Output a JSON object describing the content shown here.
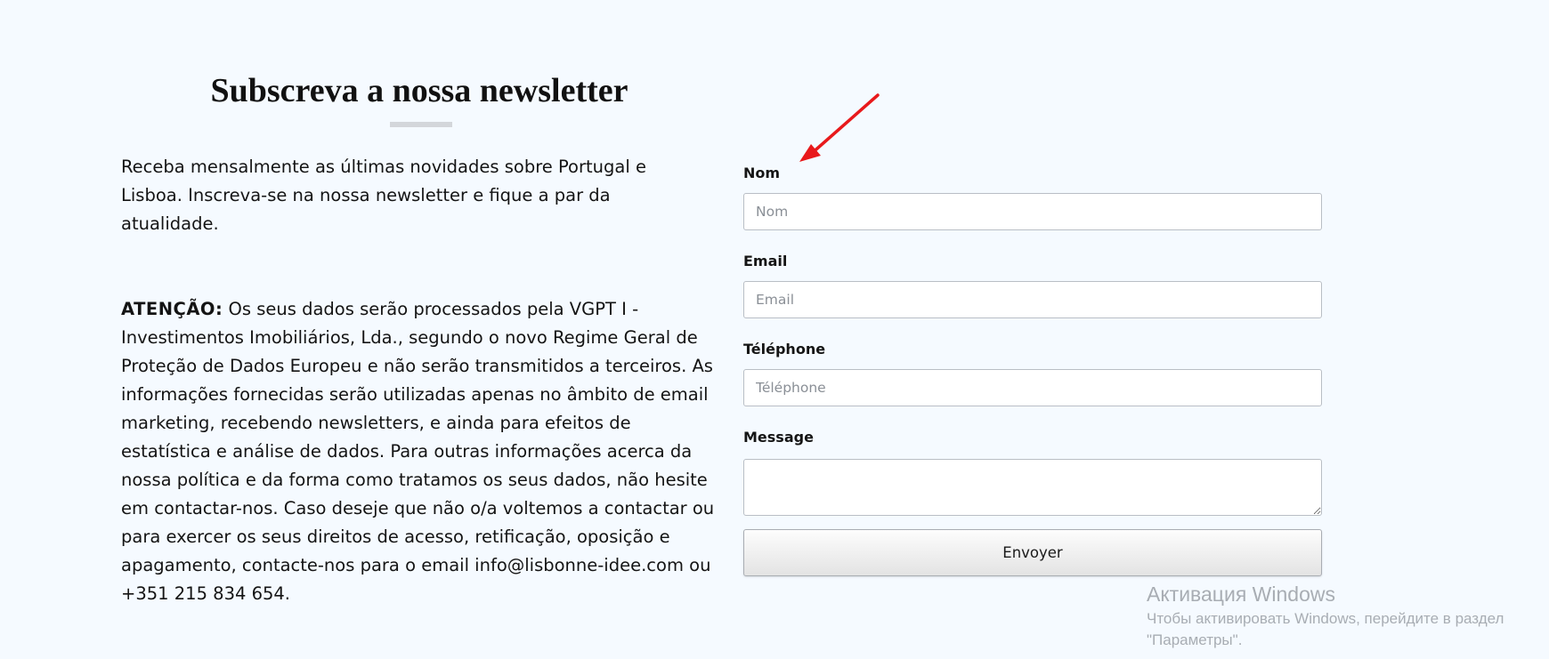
{
  "section": {
    "title": "Subscreva a nossa newsletter",
    "intro": "Receba mensalmente as últimas novidades sobre Portugal e Lisboa. Inscreva-se na nossa newsletter e fique a par da atualidade.",
    "notice_label": "ATENÇÃO:",
    "notice_text": " Os seus dados serão processados pela VGPT I - Investimentos Imobiliários, Lda., segundo o novo Regime Geral de Proteção de Dados Europeu e não serão transmitidos a terceiros. As informações fornecidas serão utilizadas apenas no âmbito de email marketing, recebendo newsletters, e ainda para efeitos de estatística e análise de dados. Para outras informações acerca da nossa política e da forma como tratamos os seus dados, não hesite em contactar-nos. Caso deseje que não o/a voltemos a contactar ou para exercer os seus direitos de acesso, retificação, oposição e apagamento, contacte-nos para o email info@lisbonne-idee.com ou +351 215 834 654."
  },
  "form": {
    "name_label": "Nom",
    "name_placeholder": "Nom",
    "name_value": "",
    "email_label": "Email",
    "email_placeholder": "Email",
    "email_value": "",
    "phone_label": "Téléphone",
    "phone_placeholder": "Téléphone",
    "phone_value": "",
    "message_label": "Message",
    "message_value": "",
    "submit_label": "Envoyer"
  },
  "annotation": {
    "arrow_color": "#e8191b"
  },
  "watermark": {
    "title": "Активация Windows",
    "line1": "Чтобы активировать Windows, перейдите в раздел",
    "line2": "\"Параметры\"."
  },
  "colors": {
    "background": "#f5faff",
    "underline": "#d3d6da"
  }
}
